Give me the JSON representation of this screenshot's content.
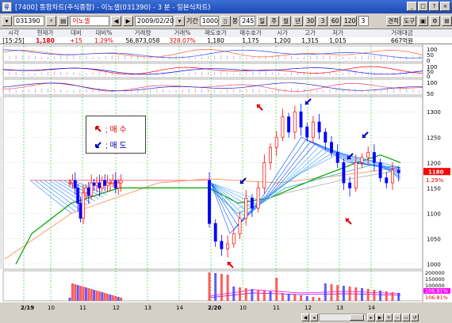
{
  "window": {
    "title": "[7400] 통합차트(주식종합) - 이노셀(031390) - 3 분 - 일본식차트)",
    "app_icon": "유",
    "buttons": [
      "_",
      "□",
      "?",
      "×"
    ]
  },
  "toolbar": {
    "code": "031390",
    "name": "이노셀",
    "date": "2009/02/20",
    "period_label": "기간",
    "period_value": "1000",
    "count_label": "봉",
    "count_value": "245",
    "unit_buttons": [
      "일",
      "주",
      "월",
      "년"
    ],
    "minute_values": [
      "30",
      "3",
      "60",
      "120",
      "3"
    ],
    "tools": [
      "견적",
      "도구"
    ]
  },
  "quote": {
    "headers": [
      "시각",
      "현재가",
      "대비",
      "대비%",
      "거래량",
      "거래%",
      "매도호가",
      "매수호가",
      "시가",
      "고가",
      "저가",
      "거래대금"
    ],
    "values": [
      "[15:25]",
      "1,180",
      "+15",
      "1.29%",
      "56,873,058",
      "328.07%",
      "1,180",
      "1,175",
      "1,200",
      "1,315",
      "1,015",
      "667억원"
    ]
  },
  "legend": {
    "buy_label": "; 매 수",
    "sell_label": "; 매 도"
  },
  "y_axis": {
    "price_ticks": [
      "1300",
      "1250",
      "1200",
      "1150",
      "1100",
      "1050",
      "1000"
    ],
    "current_price": "1180",
    "current_pct": "1.29%",
    "indicator1_ticks": [
      "100",
      "50",
      "0"
    ],
    "indicator2_ticks": [
      "100",
      "50",
      "0"
    ],
    "indicator3_ticks": [
      "100",
      "50"
    ],
    "volume_ticks": [
      "200000",
      "150000",
      "100000",
      "50000"
    ],
    "volume_pct_1": "106.81%",
    "volume_pct_2": "106.81%"
  },
  "x_axis": {
    "labels": [
      "2/19",
      "10",
      "11",
      "12",
      "13",
      "14",
      "2/20",
      "10",
      "11",
      "12",
      "13",
      "14"
    ]
  },
  "colors": {
    "titlebar": "#1c48b8",
    "up": "#ff0000",
    "down": "#0000ff",
    "ma_green": "#00a000",
    "ma_orange": "#ff8040"
  },
  "chart_data": {
    "type": "candlestick",
    "title": "",
    "xlabel": "",
    "ylabel": "",
    "ylim": [
      990,
      1330
    ],
    "series": [
      {
        "name": "",
        "values": [
          1160,
          1165,
          1150,
          1120,
          1090,
          1140,
          1150,
          1135,
          1160,
          1155,
          1160,
          1150,
          1165,
          1155,
          1160,
          1160,
          1165,
          1150,
          1160,
          1165,
          1080,
          1045,
          1030,
          1040,
          1060,
          1090,
          1130,
          1110,
          1150,
          1200,
          1230,
          1250,
          1290,
          1260,
          1300,
          1270,
          1250,
          1280,
          1260,
          1240,
          1220,
          1200,
          1160,
          1150,
          1200,
          1210,
          1220,
          1200,
          1170,
          1160,
          1185,
          1180
        ]
      }
    ],
    "annotations": [
      {
        "type": "buy",
        "label": "매수"
      },
      {
        "type": "sell",
        "label": "매도"
      }
    ]
  }
}
